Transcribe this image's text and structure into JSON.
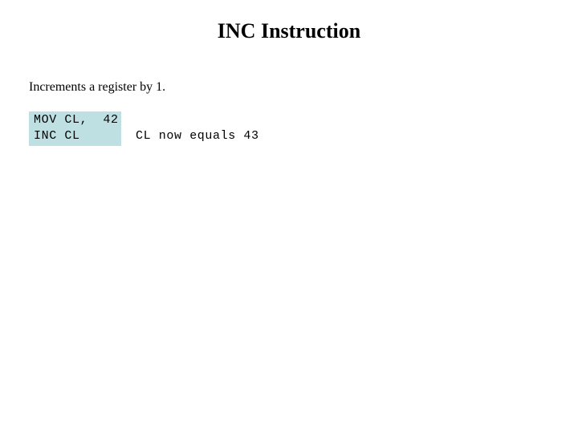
{
  "slide": {
    "title": "INC Instruction",
    "background_color": "#ffffff",
    "text_color": "#000000"
  },
  "body": {
    "description": "Increments a register by 1."
  },
  "code": {
    "highlight_color": "#bfe0e3",
    "lines": [
      "MOV CL,  42",
      "INC CL"
    ],
    "comment": "CL now equals 43"
  }
}
